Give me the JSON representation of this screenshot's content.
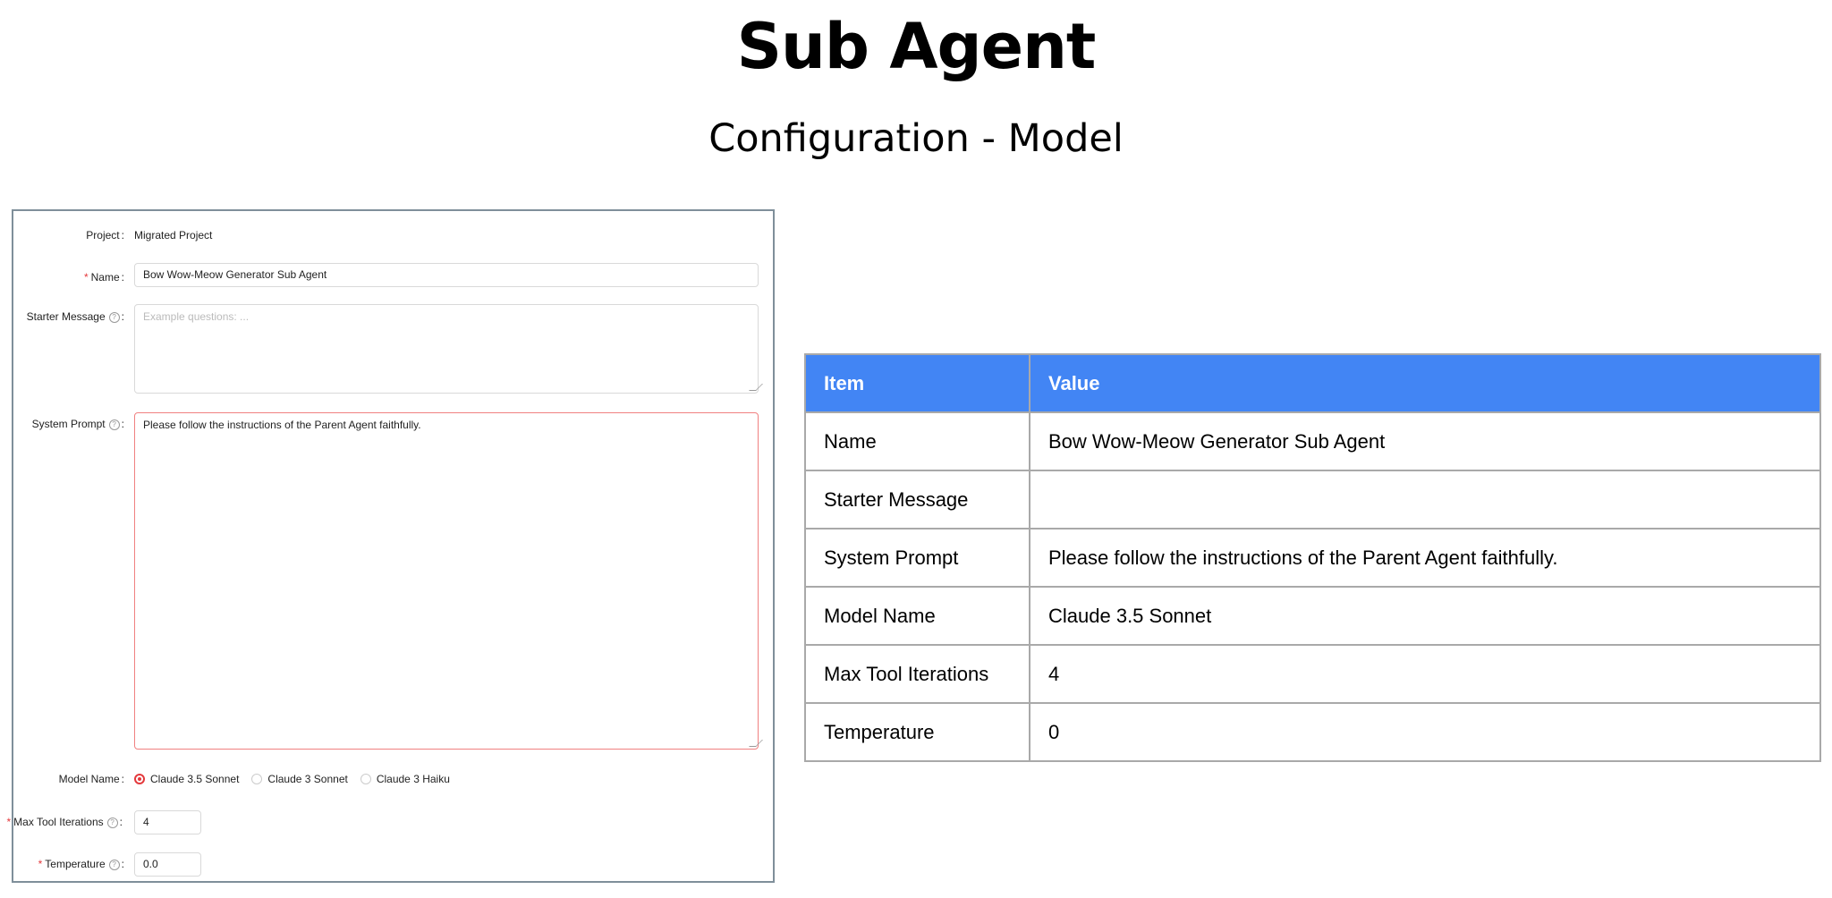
{
  "page": {
    "title": "Sub Agent",
    "subtitle": "Configuration - Model"
  },
  "form": {
    "project_label": "Project",
    "project_value": "Migrated Project",
    "name_label": "Name",
    "name_value": "Bow Wow-Meow Generator Sub Agent",
    "starter_label": "Starter Message",
    "starter_placeholder": "Example questions: ...",
    "system_label": "System Prompt",
    "system_value": "Please follow the instructions of the Parent Agent faithfully.",
    "model_label": "Model Name",
    "model_options": [
      "Claude 3.5 Sonnet",
      "Claude 3 Sonnet",
      "Claude 3 Haiku"
    ],
    "model_selected": "Claude 3.5 Sonnet",
    "max_iter_label": "Max Tool Iterations",
    "max_iter_value": "4",
    "temperature_label": "Temperature",
    "temperature_value": "0.0",
    "required_mark": "*",
    "help_icon": "question-circle-icon",
    "colon": ":"
  },
  "table": {
    "headers": [
      "Item",
      "Value"
    ],
    "rows": [
      [
        "Name",
        "Bow Wow-Meow Generator Sub Agent"
      ],
      [
        "Starter Message",
        ""
      ],
      [
        "System Prompt",
        "Please follow the instructions of the Parent Agent faithfully."
      ],
      [
        "Model Name",
        "Claude 3.5 Sonnet"
      ],
      [
        "Max Tool Iterations",
        "4"
      ],
      [
        "Temperature",
        "0"
      ]
    ]
  },
  "colors": {
    "header_bg": "#4285f4",
    "accent_red": "#e4393c",
    "panel_border": "#7f8f9a"
  }
}
